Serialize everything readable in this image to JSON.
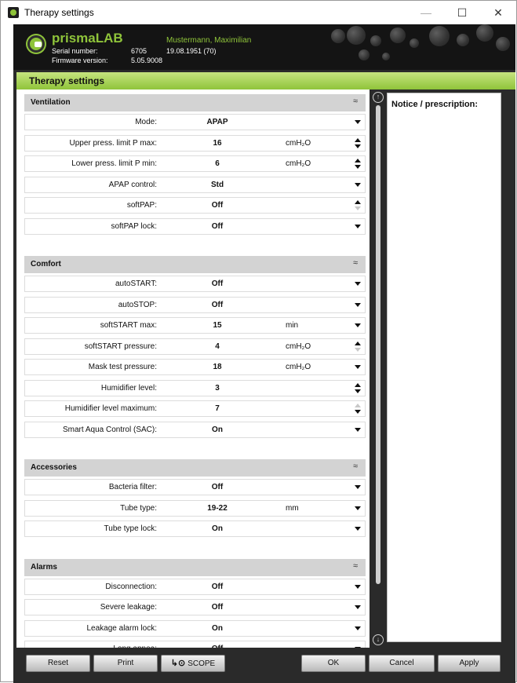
{
  "window": {
    "title": "Therapy settings",
    "minimize": "—",
    "maximize": "☐",
    "close": "✕"
  },
  "header": {
    "device_name": "prismaLAB",
    "serial_label": "Serial number:",
    "serial_value": "6705",
    "firmware_label": "Firmware version:",
    "firmware_value": "5.05.9008",
    "patient_name": "Mustermann, Maximilian",
    "patient_dob": "19.08.1951  (70)"
  },
  "section_title": "Therapy settings",
  "groups": [
    {
      "title": "Ventilation",
      "rows": [
        {
          "label": "Mode:",
          "value": "APAP",
          "unit": "",
          "control": "dropdown"
        },
        {
          "label": "Upper press. limit P max:",
          "value": "16",
          "unit": "cmH₂O",
          "control": "spin"
        },
        {
          "label": "Lower press. limit P min:",
          "value": "6",
          "unit": "cmH₂O",
          "control": "spin"
        },
        {
          "label": "APAP control:",
          "value": "Std",
          "unit": "",
          "control": "dropdown"
        },
        {
          "label": "softPAP:",
          "value": "Off",
          "unit": "",
          "control": "spin-up-only"
        },
        {
          "label": "softPAP lock:",
          "value": "Off",
          "unit": "",
          "control": "dropdown"
        }
      ]
    },
    {
      "title": "Comfort",
      "rows": [
        {
          "label": "autoSTART:",
          "value": "Off",
          "unit": "",
          "control": "dropdown"
        },
        {
          "label": "autoSTOP:",
          "value": "Off",
          "unit": "",
          "control": "dropdown"
        },
        {
          "label": "softSTART max:",
          "value": "15",
          "unit": "min",
          "control": "dropdown"
        },
        {
          "label": "softSTART pressure:",
          "value": "4",
          "unit": "cmH₂O",
          "control": "spin-up-only"
        },
        {
          "label": "Mask test pressure:",
          "value": "18",
          "unit": "cmH₂O",
          "control": "dropdown"
        },
        {
          "label": "Humidifier level:",
          "value": "3",
          "unit": "",
          "control": "spin"
        },
        {
          "label": "Humidifier level maximum:",
          "value": "7",
          "unit": "",
          "control": "spin-down-only"
        },
        {
          "label": "Smart Aqua Control (SAC):",
          "value": "On",
          "unit": "",
          "control": "dropdown"
        }
      ]
    },
    {
      "title": "Accessories",
      "rows": [
        {
          "label": "Bacteria filter:",
          "value": "Off",
          "unit": "",
          "control": "dropdown"
        },
        {
          "label": "Tube type:",
          "value": "19-22",
          "unit": "mm",
          "control": "dropdown"
        },
        {
          "label": "Tube type lock:",
          "value": "On",
          "unit": "",
          "control": "dropdown"
        }
      ]
    },
    {
      "title": "Alarms",
      "rows": [
        {
          "label": "Disconnection:",
          "value": "Off",
          "unit": "",
          "control": "dropdown"
        },
        {
          "label": "Severe leakage:",
          "value": "Off",
          "unit": "",
          "control": "dropdown"
        },
        {
          "label": "Leakage alarm lock:",
          "value": "On",
          "unit": "",
          "control": "dropdown"
        },
        {
          "label": "Long apnea:",
          "value": "Off",
          "unit": "",
          "control": "dropdown"
        }
      ]
    }
  ],
  "notice_label": "Notice / prescription:",
  "footer": {
    "reset": "Reset",
    "print": "Print",
    "scope": "SCOPE",
    "ok": "OK",
    "cancel": "Cancel",
    "apply": "Apply"
  },
  "icons": {
    "collapse": "chevrons-up-icon",
    "scroll_up": "circle-arrow-up-icon",
    "scroll_down": "circle-arrow-down-icon"
  },
  "colors": {
    "brand_green": "#8fc43a",
    "header_bg": "#141414",
    "frame_bg": "#2a2a2a",
    "group_header": "#d3d3d3"
  }
}
